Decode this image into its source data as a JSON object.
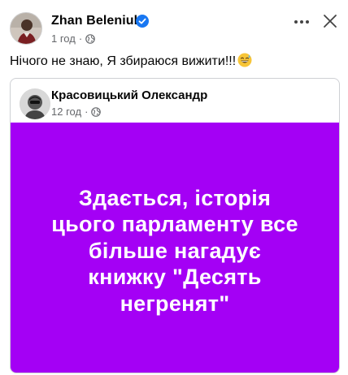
{
  "post": {
    "author": "Zhan  Beleniuk",
    "time": "1 год",
    "separator": "·",
    "text": "Нічого не знаю, Я збираюся вижити!!!",
    "emoji": "grinning-sweat-emoji",
    "verified_color": "#1877f2"
  },
  "shared": {
    "author": "Красовицький Олександр",
    "time": "12 год",
    "separator": "·",
    "image_text": "Здається, історія\nцього парламенту все\nбільше нагадує\nкнижку \"Десять\nнегренят\"",
    "image_bg": "#a400f5"
  },
  "icons": {
    "more": "more-options-icon",
    "close": "close-icon",
    "audience": "globe-icon"
  }
}
